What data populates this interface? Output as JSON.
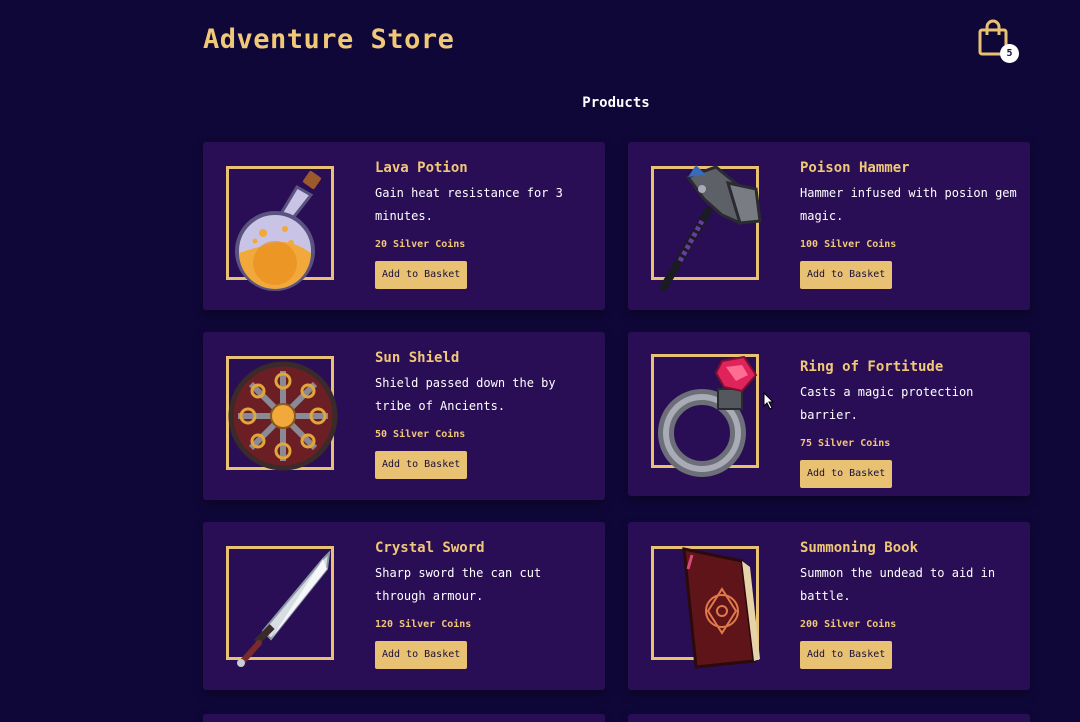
{
  "header": {
    "title": "Adventure Store",
    "cart_count": "5"
  },
  "section": {
    "heading": "Products"
  },
  "colors": {
    "background": "#0f0738",
    "card": "#2a0e55",
    "accent": "#e8c172",
    "title": "#f0c878"
  },
  "products": [
    {
      "name": "Lava Potion",
      "description": "Gain heat resistance for 3 minutes.",
      "price": "20 Silver Coins",
      "button": "Add to Basket",
      "icon": "lava-potion-icon"
    },
    {
      "name": "Poison Hammer",
      "description": "Hammer infused with posion gem magic.",
      "price": "100 Silver Coins",
      "button": "Add to Basket",
      "icon": "poison-hammer-icon"
    },
    {
      "name": "Sun Shield",
      "description": "Shield passed down the by tribe of Ancients.",
      "price": "50 Silver Coins",
      "button": "Add to Basket",
      "icon": "sun-shield-icon"
    },
    {
      "name": "Ring of Fortitude",
      "description": "Casts a magic protection barrier.",
      "price": "75 Silver Coins",
      "button": "Add to Basket",
      "icon": "ring-icon"
    },
    {
      "name": "Crystal Sword",
      "description": "Sharp sword the can cut through armour.",
      "price": "120 Silver Coins",
      "button": "Add to Basket",
      "icon": "crystal-sword-icon"
    },
    {
      "name": "Summoning Book",
      "description": "Summon the undead to aid in battle.",
      "price": "200 Silver Coins",
      "button": "Add to Basket",
      "icon": "summoning-book-icon"
    }
  ]
}
